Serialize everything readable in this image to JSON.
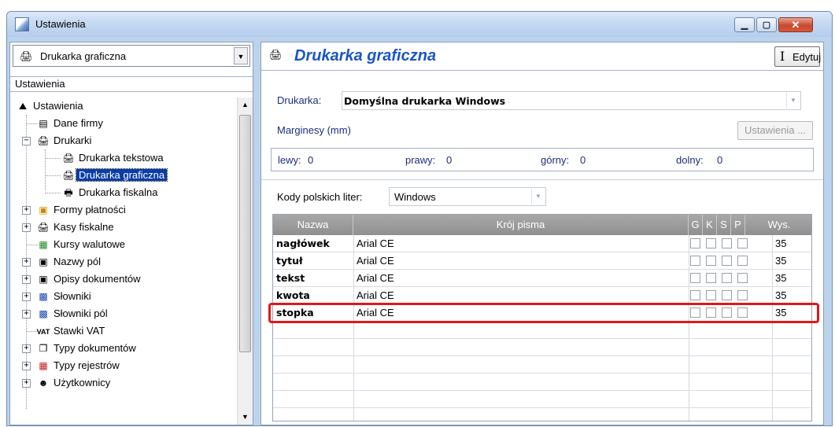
{
  "window": {
    "title": "Ustawienia"
  },
  "left": {
    "combo_value": "Drukarka graficzna",
    "section_label": "Ustawienia",
    "tree": [
      {
        "label": "Ustawienia",
        "icon": "network-icon"
      },
      {
        "label": "Dane firmy",
        "icon": "company-icon"
      },
      {
        "label": "Drukarki",
        "icon": "printer-icon"
      },
      {
        "label": "Drukarka tekstowa",
        "icon": "printer-icon"
      },
      {
        "label": "Drukarka graficzna",
        "icon": "printer-icon",
        "selected": true
      },
      {
        "label": "Drukarka fiskalna",
        "icon": "fiscal-printer-icon"
      },
      {
        "label": "Formy płatności",
        "icon": "payment-icon"
      },
      {
        "label": "Kasy fiskalne",
        "icon": "cash-register-icon"
      },
      {
        "label": "Kursy walutowe",
        "icon": "grid-icon"
      },
      {
        "label": "Nazwy pól",
        "icon": "floppy-icon"
      },
      {
        "label": "Opisy dokumentów",
        "icon": "floppy-icon"
      },
      {
        "label": "Słowniki",
        "icon": "dictionary-icon"
      },
      {
        "label": "Słowniki pól",
        "icon": "dictionary-icon"
      },
      {
        "label": "Stawki VAT",
        "icon": "vat-icon"
      },
      {
        "label": "Typy dokumentów",
        "icon": "documents-icon"
      },
      {
        "label": "Typy rejestrów",
        "icon": "register-icon"
      },
      {
        "label": "Użytkownicy",
        "icon": "users-icon"
      }
    ]
  },
  "right": {
    "heading": "Drukarka graficzna",
    "edit_label": "Edytuj",
    "printer_label": "Drukarka:",
    "printer_value": "Domyślna drukarka Windows",
    "margins_label": "Marginesy (mm)",
    "settings_button": "Ustawienia ...",
    "margins": {
      "left_label": "lewy:",
      "left_value": "0",
      "right_label": "prawy:",
      "right_value": "0",
      "top_label": "górny:",
      "top_value": "0",
      "bottom_label": "dolny:",
      "bottom_value": "0"
    },
    "codes_label": "Kody polskich liter:",
    "codes_value": "Windows",
    "grid": {
      "headers": {
        "name": "Nazwa",
        "font": "Krój pisma",
        "g": "G",
        "k": "K",
        "s": "S",
        "p": "P",
        "height": "Wys."
      },
      "rows": [
        {
          "name": "nagłówek",
          "font": "Arial CE",
          "height": "35"
        },
        {
          "name": "tytuł",
          "font": "Arial CE",
          "height": "35"
        },
        {
          "name": "tekst",
          "font": "Arial CE",
          "height": "35"
        },
        {
          "name": "kwota",
          "font": "Arial CE",
          "height": "35",
          "highlighted": true
        },
        {
          "name": "stopka",
          "font": "Arial CE",
          "height": "35"
        }
      ]
    }
  },
  "colors": {
    "heading": "#1a56c4",
    "selection": "#0a3da8",
    "highlight": "#e01818"
  }
}
